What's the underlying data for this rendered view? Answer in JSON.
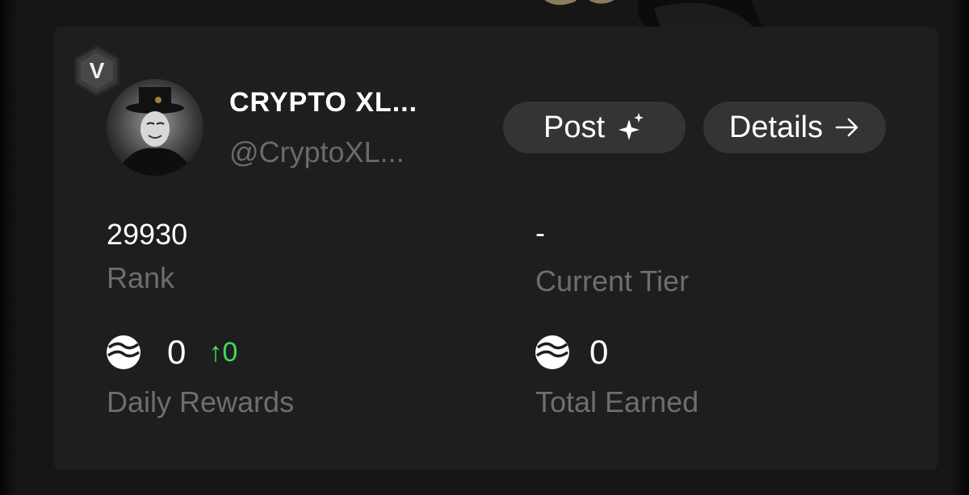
{
  "profile": {
    "verified_badge": "V",
    "name": "CRYPTO XL...",
    "handle": "@CryptoXL...",
    "avatar_icon": "masked-figure-avatar"
  },
  "actions": {
    "post_label": "Post",
    "post_icon": "sparkle-icon",
    "details_label": "Details",
    "details_icon": "arrow-right-icon"
  },
  "stats": {
    "rank_value": "29930",
    "rank_label": "Rank",
    "tier_value": "-",
    "tier_label": "Current Tier",
    "daily_value": "0",
    "daily_delta": "↑0",
    "daily_label": "Daily Rewards",
    "total_value": "0",
    "total_label": "Total Earned",
    "coin_icon": "token-coin-icon"
  },
  "colors": {
    "card_bg": "#1e1e1e",
    "button_bg": "#343434",
    "muted_text": "#6e6e6e",
    "positive": "#3ddc5c"
  }
}
